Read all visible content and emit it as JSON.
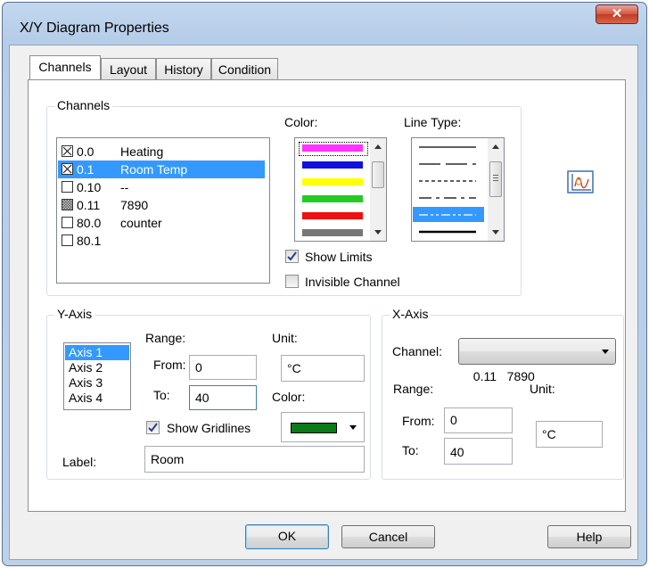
{
  "window": {
    "title": "X/Y Diagram Properties",
    "close_glyph": "✕"
  },
  "tabs": [
    {
      "label": "Channels",
      "active": true
    },
    {
      "label": "Layout"
    },
    {
      "label": "History"
    },
    {
      "label": "Condition"
    }
  ],
  "channels_group": {
    "title": "Channels",
    "items": [
      {
        "id": "0.0",
        "name": "Heating",
        "state": "crossed",
        "selected": false
      },
      {
        "id": "0.1",
        "name": "Room Temp",
        "state": "crossed",
        "selected": true
      },
      {
        "id": "0.10",
        "name": "--",
        "state": "unchecked",
        "selected": false
      },
      {
        "id": "0.11",
        "name": "7890",
        "state": "indeterminate",
        "selected": false
      },
      {
        "id": "80.0",
        "name": "counter",
        "state": "unchecked",
        "selected": false
      },
      {
        "id": "80.1",
        "name": "",
        "state": "unchecked",
        "selected": false
      }
    ],
    "color_label": "Color:",
    "colors": [
      "#ff33ff",
      "#1010dd",
      "#ffff00",
      "#22cc22",
      "#ee1111",
      "#777777"
    ],
    "line_type_label": "Line Type:",
    "line_types": [
      "solid",
      "long-dash",
      "short-dash",
      "dash-dot",
      "dash-dot-dot",
      "thick"
    ],
    "selected_line_type": 4,
    "show_limits": {
      "label": "Show Limits",
      "checked": true
    },
    "invisible_channel": {
      "label": "Invisible Channel",
      "checked": false
    }
  },
  "y_axis": {
    "title": "Y-Axis",
    "axes": [
      "Axis 1",
      "Axis 2",
      "Axis 3",
      "Axis 4"
    ],
    "selected_axis": 0,
    "range_label": "Range:",
    "from_label": "From:",
    "from_value": "0",
    "to_label": "To:",
    "to_value": "40",
    "unit_label": "Unit:",
    "unit_value": "°C",
    "color_label": "Color:",
    "color_value": "#0b7a18",
    "show_gridlines": {
      "label": "Show Gridlines",
      "checked": true
    },
    "label_label": "Label:",
    "label_value": "Room"
  },
  "x_axis": {
    "title": "X-Axis",
    "channel_label": "Channel:",
    "channel_value": "0.11   7890",
    "range_label": "Range:",
    "from_label": "From:",
    "from_value": "0",
    "to_label": "To:",
    "to_value": "40",
    "unit_label": "Unit:",
    "unit_value": "°C"
  },
  "buttons": {
    "ok": "OK",
    "cancel": "Cancel",
    "help": "Help"
  },
  "side_icon": "xy-diagram-icon"
}
